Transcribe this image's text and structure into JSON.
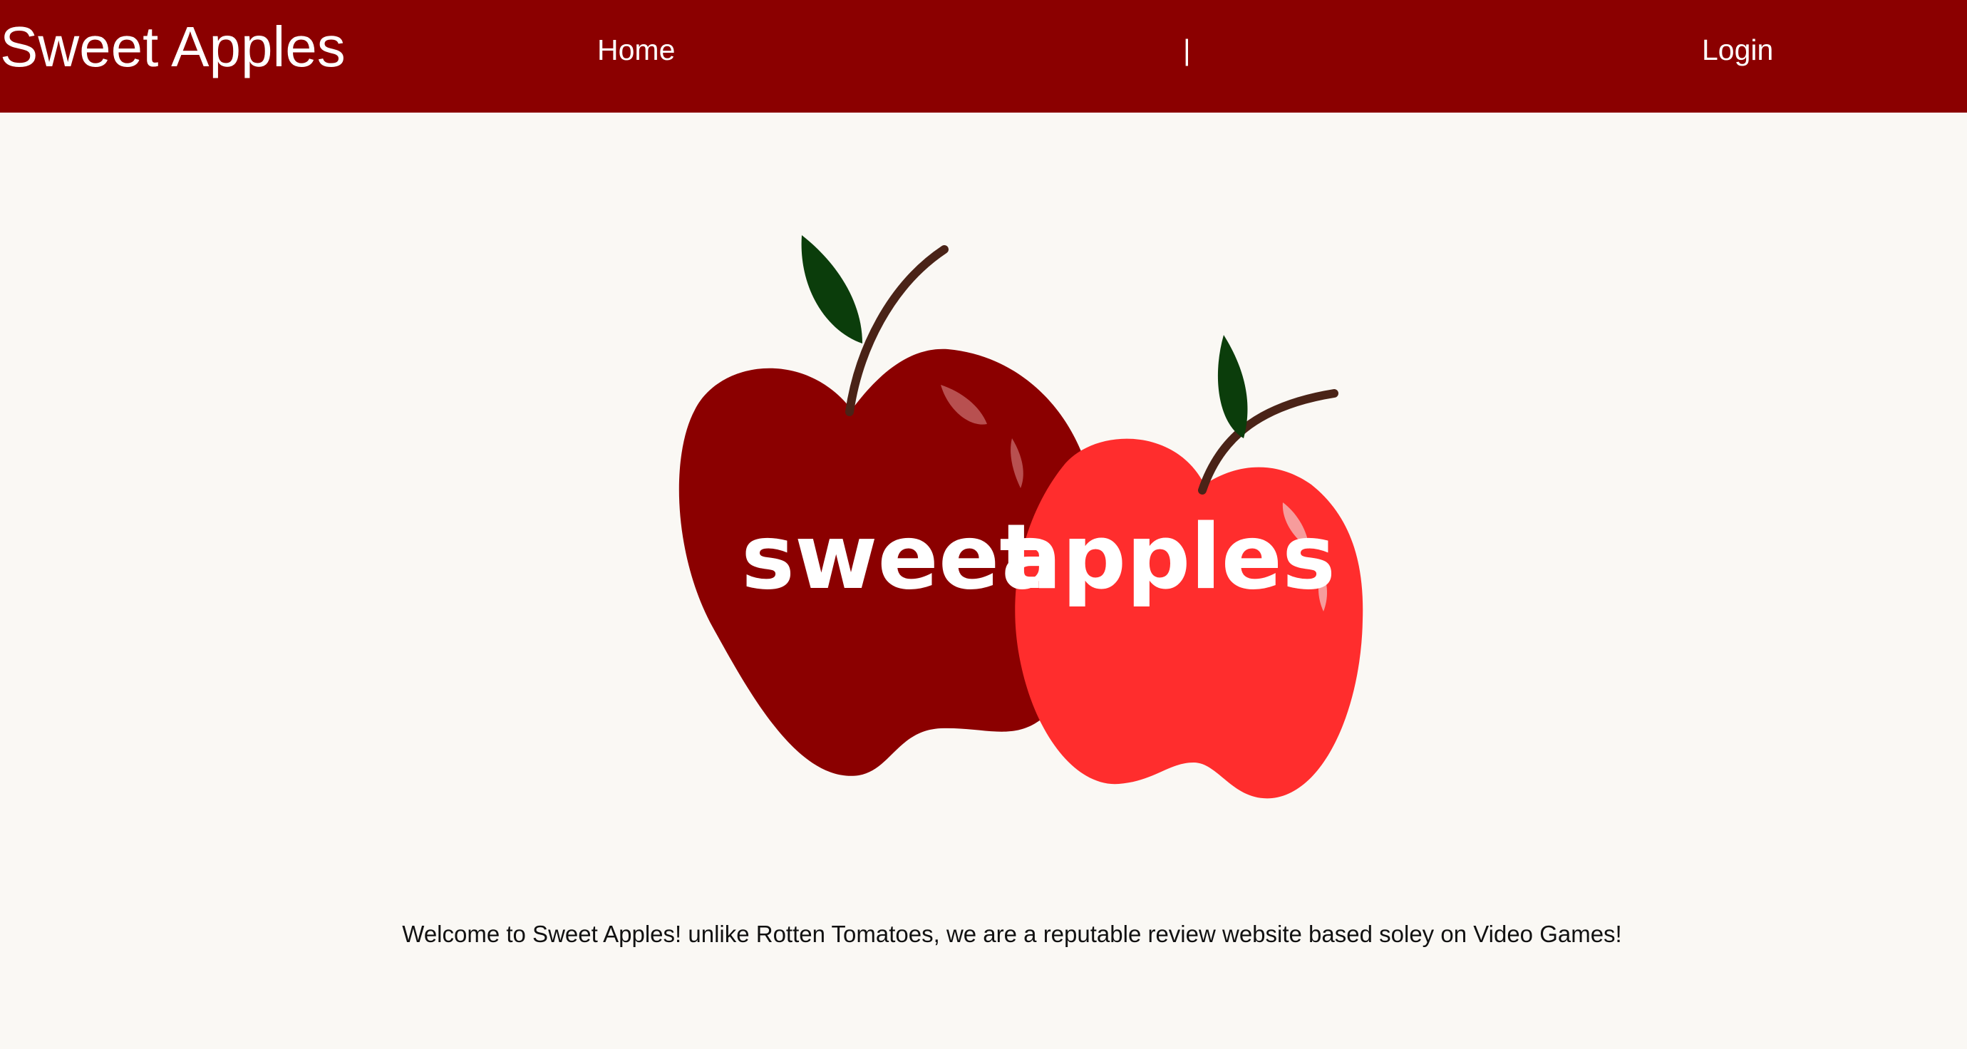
{
  "header": {
    "brand": "Sweet Apples",
    "nav": {
      "home": "Home",
      "separator": "|",
      "login": "Login"
    }
  },
  "logo": {
    "text_left": "sweet",
    "text_right": "apples",
    "colors": {
      "dark_apple": "#8b0000",
      "bright_apple": "#ff2d2d",
      "leaf": "#0b3d0b",
      "stem": "#4a2317",
      "text": "#ffffff"
    }
  },
  "main": {
    "welcome": "Welcome to Sweet Apples! unlike Rotten Tomatoes, we are a reputable review website based soley on Video Games!"
  },
  "theme": {
    "navbar_bg": "#8b0000",
    "page_bg": "#faf8f4"
  }
}
